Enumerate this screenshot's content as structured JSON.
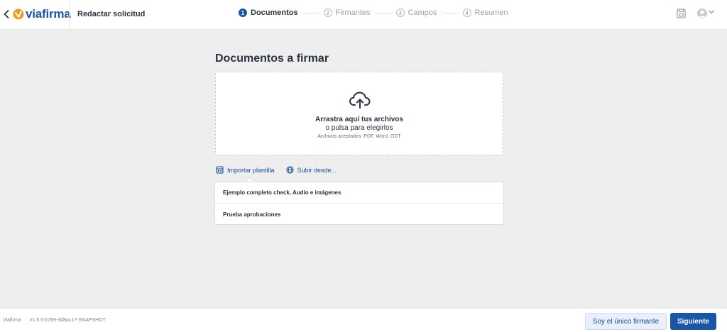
{
  "header": {
    "back_icon": "chevron-left-icon",
    "logo_text": "viafirma",
    "title": "Redactar solicitud",
    "steps": [
      {
        "num": "1",
        "label": "Documentos",
        "active": true
      },
      {
        "num": "2",
        "label": "Firmantes",
        "active": false
      },
      {
        "num": "3",
        "label": "Campos",
        "active": false
      },
      {
        "num": "4",
        "label": "Resumen",
        "active": false
      }
    ],
    "right_icons": [
      "save-icon",
      "user-avatar-icon",
      "chevron-down-icon"
    ]
  },
  "main": {
    "title": "Documentos a firmar",
    "dropzone": {
      "icon": "cloud-upload-icon",
      "title": "Arrastra aquí tus archivos",
      "subtitle": "o pulsa para elegirlos",
      "note": "Archivos aceptados: PDF, Word, ODT"
    },
    "actions": {
      "import_label": "Importar plantilla",
      "import_icon": "template-icon",
      "upload_label": "Subir desde...",
      "upload_icon": "globe-icon"
    },
    "templates": [
      "Ejemplo completo check, Audio e imágenes",
      "Prueba aprobaciones"
    ]
  },
  "footer": {
    "app_name": "Viafirma",
    "separator": "·",
    "version": "v1.5.5-b769-3d8ac17-SNAPSHOT",
    "secondary_button": "Soy el único firmante",
    "primary_button": "Siguiente"
  },
  "colors": {
    "accent": "#1a56a8",
    "logo_orange": "#f39a1c",
    "background": "#eeeeef"
  }
}
